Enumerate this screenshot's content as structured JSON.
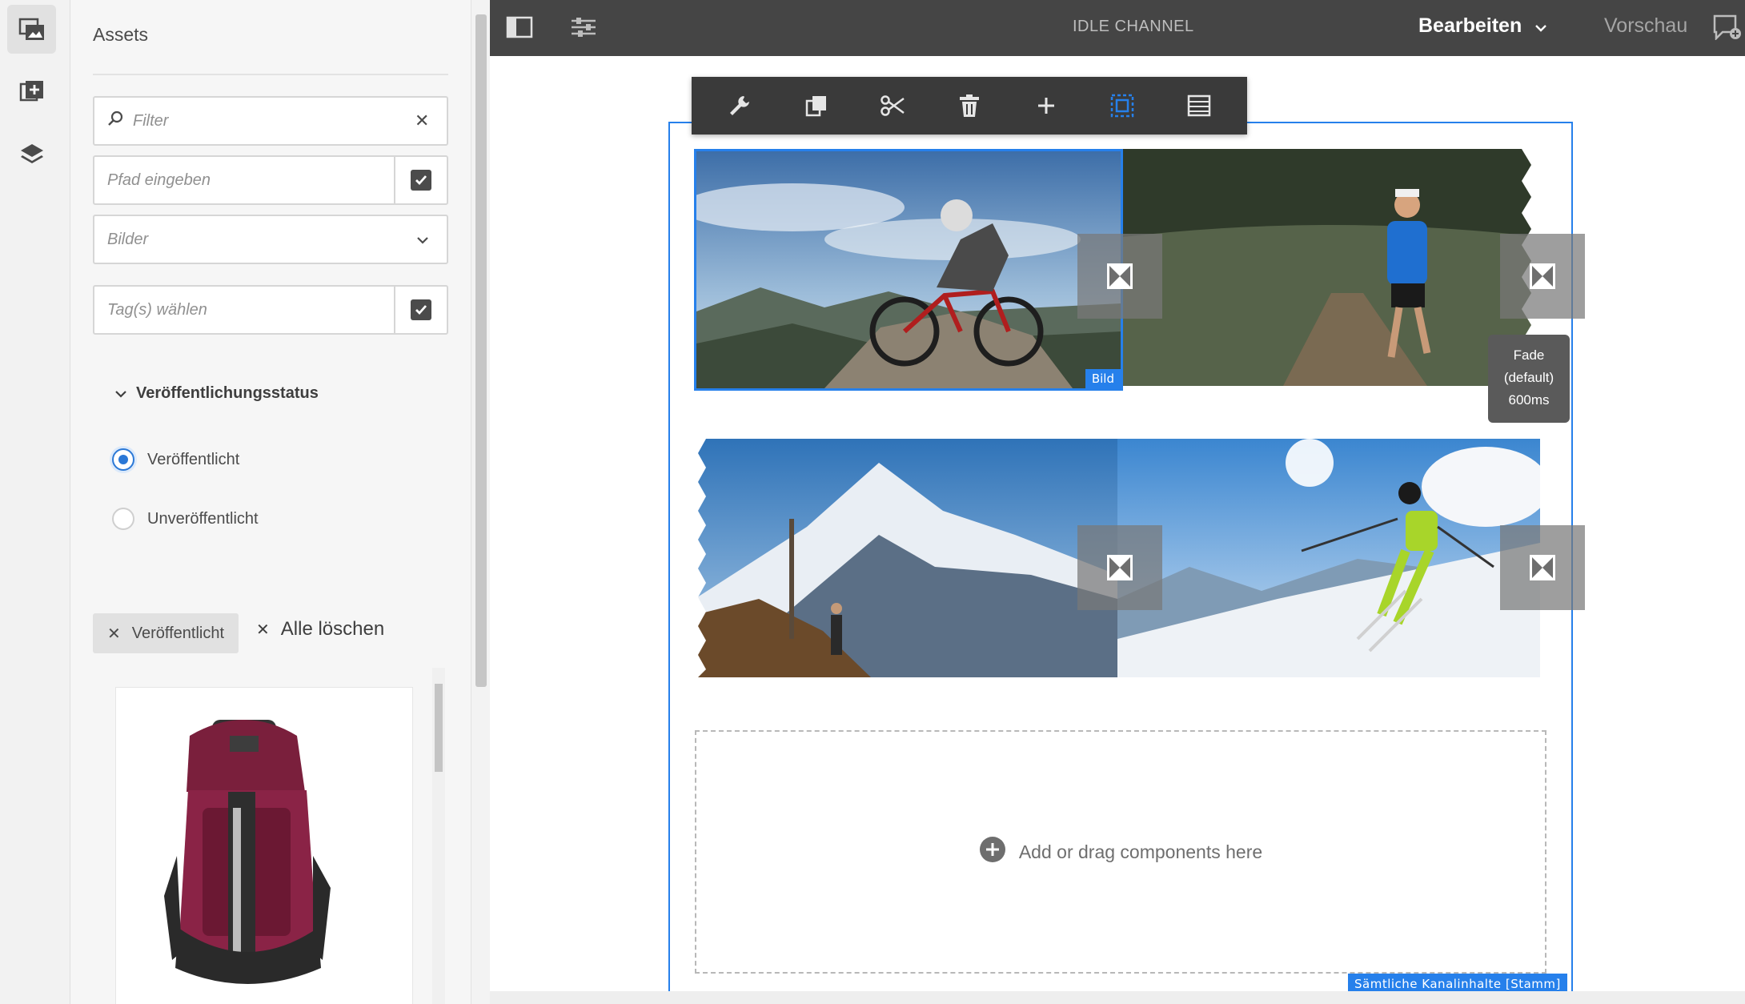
{
  "panel": {
    "title": "Assets",
    "filter_placeholder": "Filter",
    "path_placeholder": "Pfad eingeben",
    "type_select": "Bilder",
    "tags_placeholder": "Tag(s) wählen",
    "section_title": "Veröffentlichungsstatus",
    "radio_published": "Veröffentlicht",
    "radio_unpublished": "Unveröffentlicht",
    "active_tag": "Veröffentlicht",
    "clear_all": "Alle löschen"
  },
  "topbar": {
    "title": "IDLE CHANNEL",
    "mode": "Bearbeiten",
    "preview": "Vorschau"
  },
  "canvas": {
    "image_badge": "Bild",
    "tooltip_line1": "Fade",
    "tooltip_line2": "(default)",
    "tooltip_line3": "600ms",
    "dropzone_text": "Add or drag components here",
    "container_label": "Sämtliche Kanalinhalte [Stamm]"
  },
  "icons": {
    "rail": [
      "assets-icon",
      "components-icon",
      "layers-icon"
    ],
    "toolbar": [
      "wrench-icon",
      "copy-icon",
      "cut-icon",
      "delete-icon",
      "add-icon",
      "group-icon",
      "layout-icon"
    ]
  },
  "colors": {
    "accent": "#2680eb",
    "topbar": "#454545",
    "toolbar": "#3a3a3a"
  }
}
